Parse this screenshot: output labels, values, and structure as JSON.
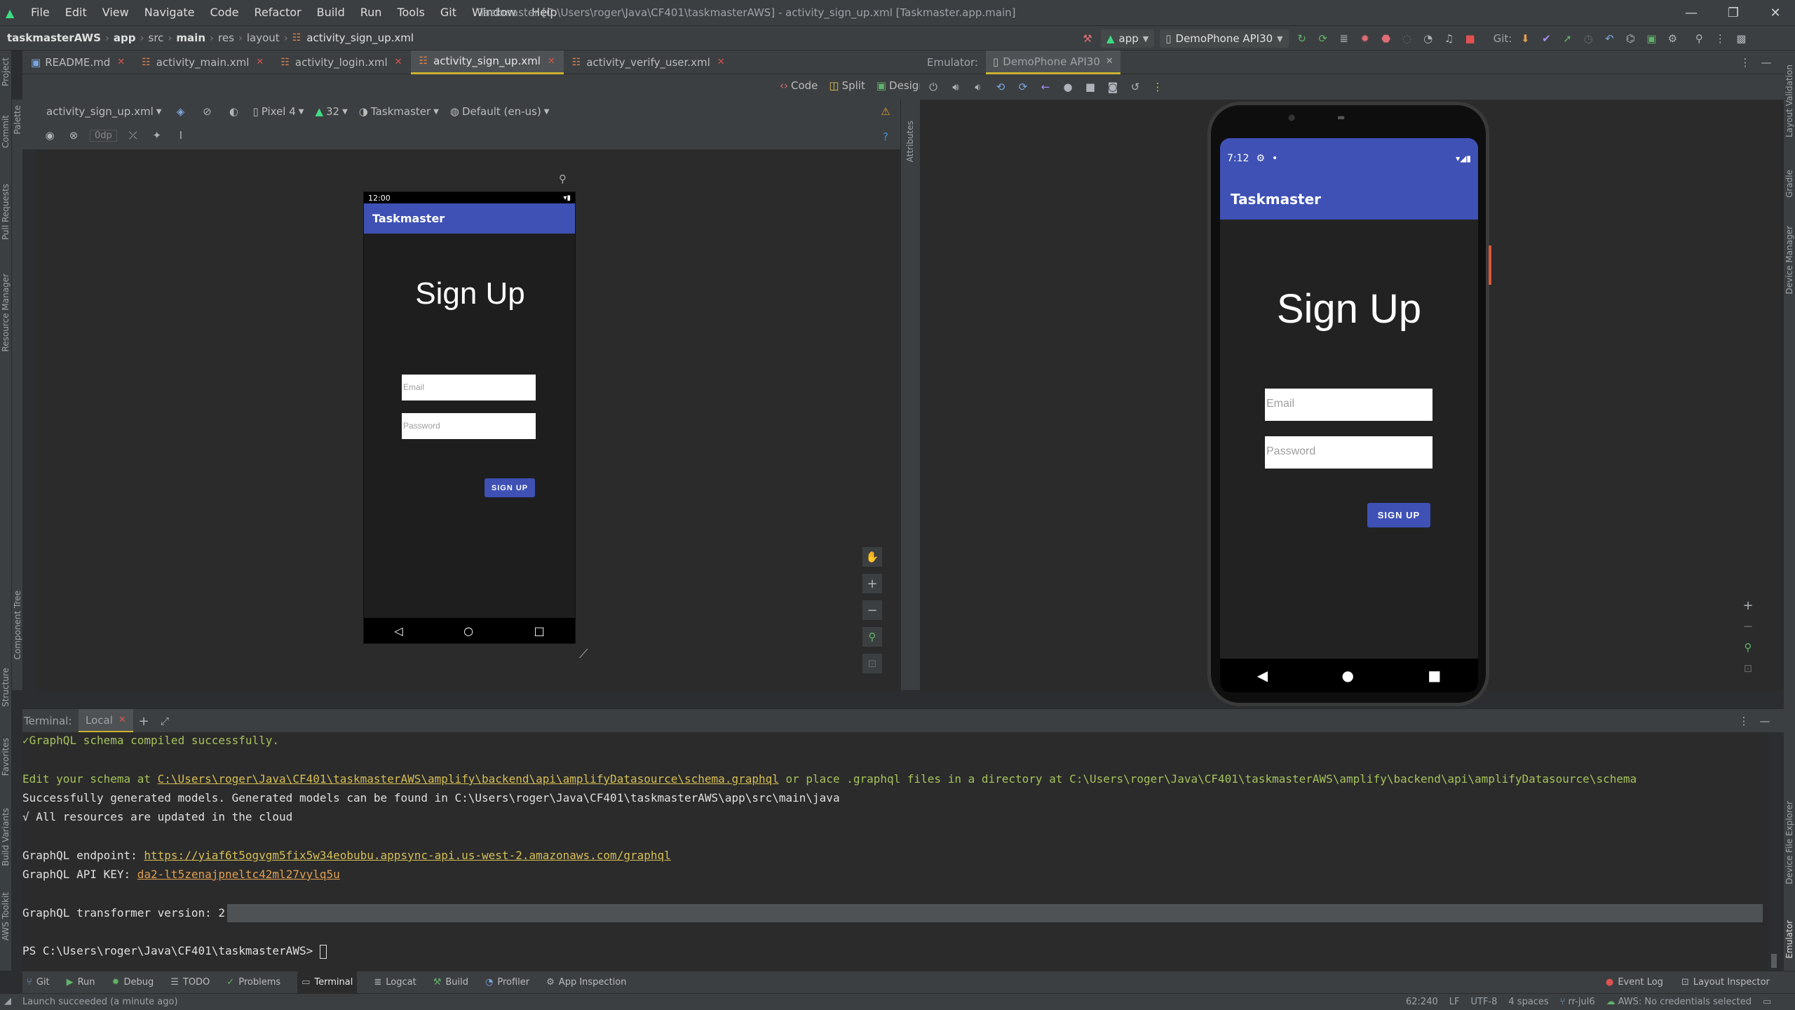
{
  "window": {
    "title": "Taskmaster [C:\\Users\\roger\\Java\\CF401\\taskmasterAWS] - activity_sign_up.xml [Taskmaster.app.main]",
    "menu": [
      "File",
      "Edit",
      "View",
      "Navigate",
      "Code",
      "Refactor",
      "Build",
      "Run",
      "Tools",
      "Git",
      "Window",
      "Help"
    ]
  },
  "breadcrumb": [
    "taskmasterAWS",
    "app",
    "src",
    "main",
    "res",
    "layout",
    "activity_sign_up.xml"
  ],
  "run_config": {
    "module": "app",
    "device": "DemoPhone API30",
    "git_label": "Git:"
  },
  "left_strip": [
    "Project",
    "Commit",
    "Pull Requests",
    "Resource Manager",
    "Structure",
    "Favorites",
    "Build Variants",
    "AWS Toolkit"
  ],
  "right_strip": [
    "Layout Validation",
    "Gradle",
    "Device Manager",
    "Device File Explorer",
    "Emulator"
  ],
  "palette_strip": [
    "Palette",
    "Component Tree"
  ],
  "attributes_label": "Attributes",
  "tabs": [
    {
      "label": "README.md",
      "active": false
    },
    {
      "label": "activity_main.xml",
      "active": false
    },
    {
      "label": "activity_login.xml",
      "active": false
    },
    {
      "label": "activity_sign_up.xml",
      "active": true
    },
    {
      "label": "activity_verify_user.xml",
      "active": false
    }
  ],
  "view_modes": [
    "Code",
    "Split",
    "Design"
  ],
  "design_toolbar": {
    "file": "activity_sign_up.xml",
    "device": "Pixel 4",
    "api": "32",
    "theme": "Taskmaster",
    "locale": "Default (en-us)",
    "margin": "0dp"
  },
  "preview": {
    "time": "12:00",
    "app_title": "Taskmaster",
    "heading": "Sign Up",
    "email_placeholder": "Email",
    "password_placeholder": "Password",
    "button": "SIGN UP"
  },
  "emulator": {
    "label": "Emulator:",
    "tab": "DemoPhone API30",
    "time": "7:12",
    "app_title": "Taskmaster",
    "heading": "Sign Up",
    "email_placeholder": "Email",
    "password_placeholder": "Password",
    "button": "SIGN UP"
  },
  "terminal": {
    "label": "Terminal:",
    "tab": "Local",
    "lines": {
      "l1": "GraphQL schema compiled successfully.",
      "l2a": "Edit your schema at ",
      "l2b": "C:\\Users\\roger\\Java\\CF401\\taskmasterAWS\\amplify\\backend\\api\\amplifyDatasource\\schema.graphql",
      "l2c": " or place .graphql files in a directory at C:\\Users\\roger\\Java\\CF401\\taskmasterAWS\\amplify\\backend\\api\\amplifyDatasource\\schema",
      "l3": "Successfully generated models. Generated models can be found in C:\\Users\\roger\\Java\\CF401\\taskmasterAWS\\app\\src\\main\\java",
      "l4": "√ All resources are updated in the cloud",
      "l5a": "GraphQL endpoint: ",
      "l5b": "https://yiaf6t5ogvgm5fix5w34eobubu.appsync-api.us-west-2.amazonaws.com/graphql",
      "l6a": "GraphQL API KEY: ",
      "l6b": "da2-lt5zenajpneltc42ml27vylq5u",
      "l7": "GraphQL transformer version: 2",
      "prompt": "PS C:\\Users\\roger\\Java\\CF401\\taskmasterAWS>"
    }
  },
  "bottom_tools": [
    "Git",
    "Run",
    "Debug",
    "TODO",
    "Problems",
    "Terminal",
    "Logcat",
    "Build",
    "Profiler",
    "App Inspection"
  ],
  "bottom_right_tools": [
    "Event Log",
    "Layout Inspector"
  ],
  "status": {
    "message": "Launch succeeded (a minute ago)",
    "position": "62:240",
    "line_sep": "LF",
    "encoding": "UTF-8",
    "indent": "4 spaces",
    "branch": "rr-jul6",
    "aws": "AWS: No credentials selected"
  }
}
